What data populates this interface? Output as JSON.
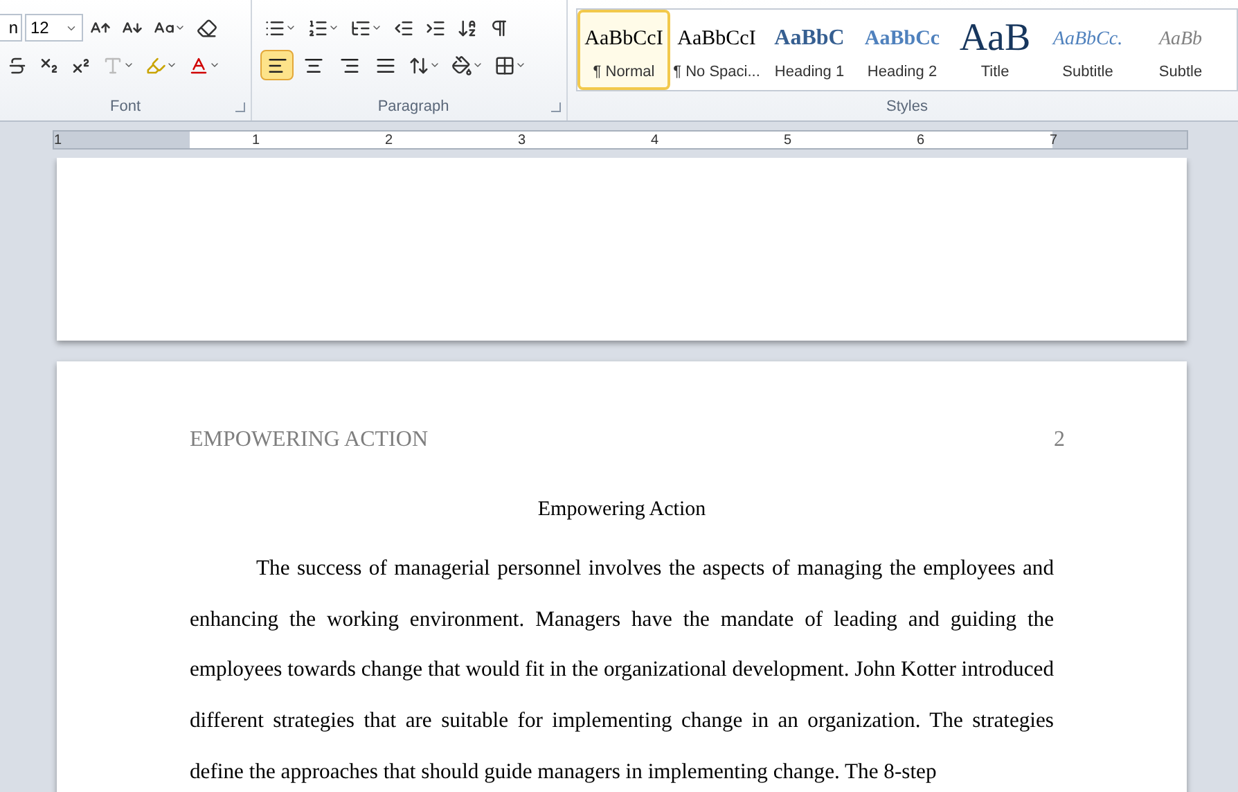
{
  "font_group": {
    "font_name": "n",
    "font_size": "12",
    "label": "Font"
  },
  "paragraph_group": {
    "label": "Paragraph",
    "alignments": [
      {
        "kind": "left",
        "selected": true
      },
      {
        "kind": "center",
        "selected": false
      },
      {
        "kind": "right",
        "selected": false
      },
      {
        "kind": "justify",
        "selected": false
      }
    ],
    "show_marks": false
  },
  "styles_group": {
    "label": "Styles",
    "styles": [
      {
        "kind": "normal",
        "preview": "AaBbCcI",
        "label": "¶ Normal",
        "selected": true
      },
      {
        "kind": "normal",
        "preview": "AaBbCcI",
        "label": "¶ No Spaci...",
        "selected": false
      },
      {
        "kind": "heading1",
        "preview": "AaBbC",
        "label": "Heading 1",
        "selected": false
      },
      {
        "kind": "heading2",
        "preview": "AaBbCc",
        "label": "Heading 2",
        "selected": false
      },
      {
        "kind": "title",
        "preview": "AaB",
        "label": "Title",
        "selected": false
      },
      {
        "kind": "subtitle",
        "preview": "AaBbCc.",
        "label": "Subtitle",
        "selected": false
      },
      {
        "kind": "subtle",
        "preview": "AaBb",
        "label": "Subtle",
        "selected": false
      }
    ]
  },
  "ruler": {
    "labels": [
      "1",
      "1",
      "2",
      "3",
      "4",
      "5",
      "6",
      "7"
    ]
  },
  "page": {
    "header": "EMPOWERING ACTION",
    "page_number": "2",
    "title": "Empowering Action",
    "paragraph": "The success of managerial personnel involves the aspects of managing the employees and enhancing the working environment. Managers have the mandate of leading and guiding the employees towards change that would fit in the organizational development. John Kotter introduced different strategies that are suitable for implementing change in an organization. The strategies define the approaches that should guide managers in implementing change. The 8-step"
  }
}
